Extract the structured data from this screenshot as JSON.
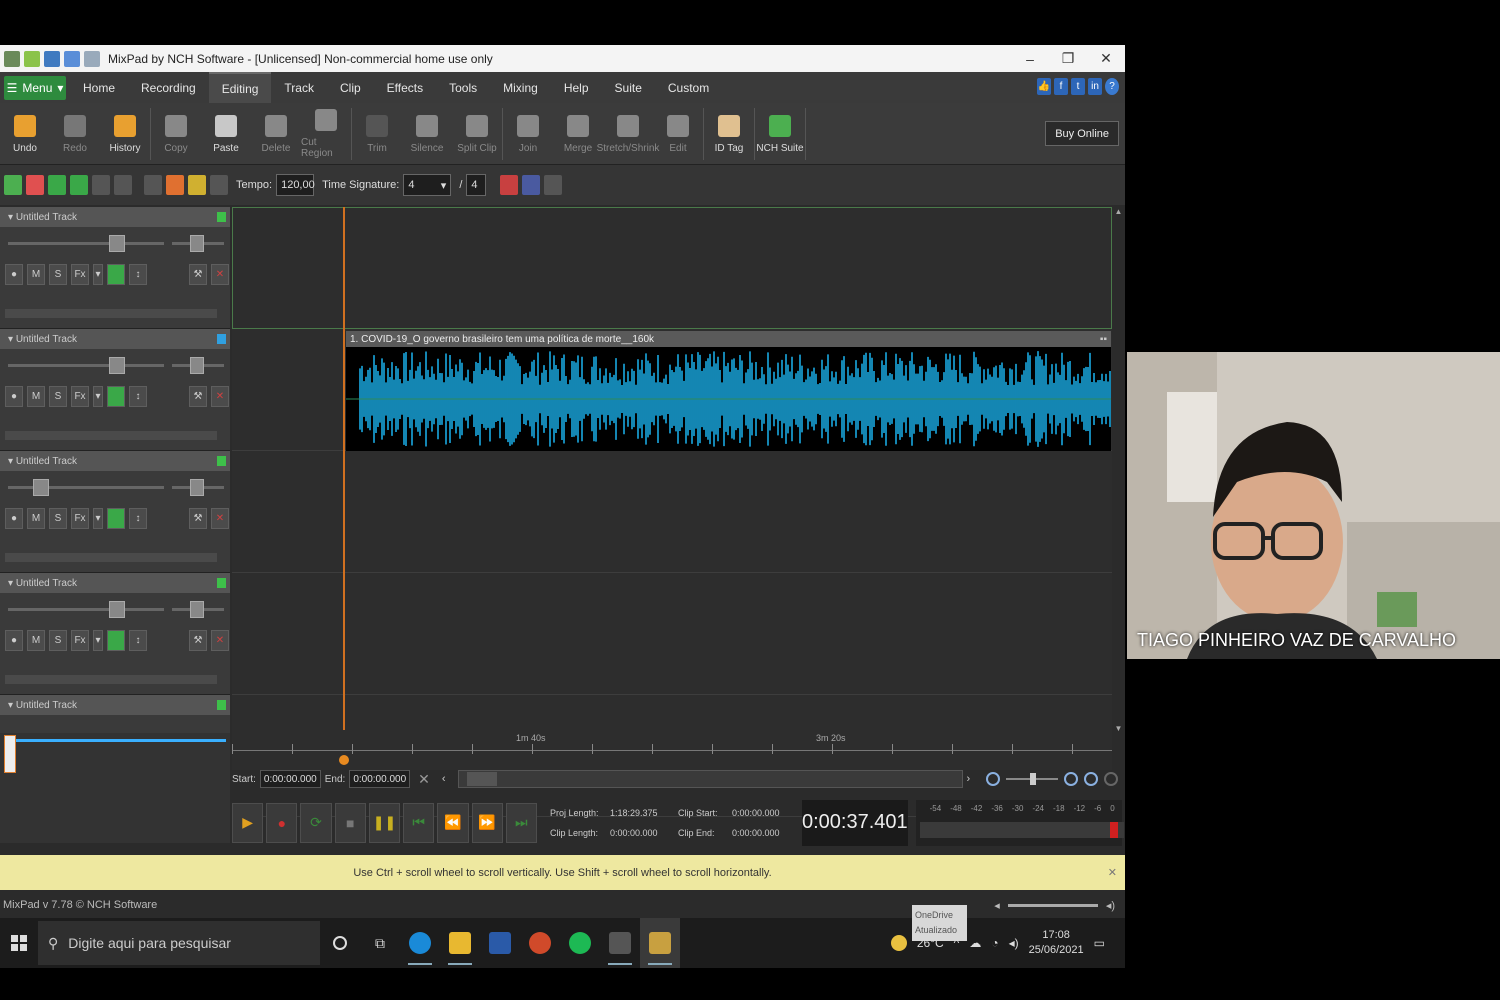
{
  "window": {
    "title": "MixPad by NCH Software - [Unlicensed] Non-commercial home use only",
    "controls": [
      "–",
      "❐",
      "✕"
    ]
  },
  "menu": {
    "menu_button": "Menu",
    "tabs": [
      "Home",
      "Recording",
      "Editing",
      "Track",
      "Clip",
      "Effects",
      "Tools",
      "Mixing",
      "Help",
      "Suite",
      "Custom"
    ],
    "active_tab": "Editing"
  },
  "toolbar": {
    "buttons": [
      {
        "label": "Undo",
        "enabled": true,
        "color": "#e8a030"
      },
      {
        "label": "Redo",
        "enabled": false,
        "color": "#777777"
      },
      {
        "label": "History",
        "enabled": true,
        "color": "#e8a030"
      },
      {
        "label": "Copy",
        "enabled": false,
        "color": "#888888"
      },
      {
        "label": "Paste",
        "enabled": true,
        "color": "#c8c8c8"
      },
      {
        "label": "Delete",
        "enabled": false,
        "color": "#888888"
      },
      {
        "label": "Cut Region",
        "enabled": false,
        "color": "#888888"
      },
      {
        "label": "Trim",
        "enabled": false,
        "color": "#555555"
      },
      {
        "label": "Silence",
        "enabled": false,
        "color": "#888888"
      },
      {
        "label": "Split Clip",
        "enabled": false,
        "color": "#888888"
      },
      {
        "label": "Join",
        "enabled": false,
        "color": "#888888"
      },
      {
        "label": "Merge",
        "enabled": false,
        "color": "#888888"
      },
      {
        "label": "Stretch/Shrink",
        "enabled": false,
        "color": "#888888"
      },
      {
        "label": "Edit",
        "enabled": false,
        "color": "#888888"
      },
      {
        "label": "ID Tag",
        "enabled": true,
        "color": "#e0c090"
      },
      {
        "label": "NCH Suite",
        "enabled": true,
        "color": "#4caf50"
      }
    ],
    "buy_online": "Buy Online"
  },
  "toolbar2": {
    "tempo_label": "Tempo:",
    "tempo_value": "120,00",
    "time_sig_label": "Time Signature:",
    "time_sig_num": "4",
    "time_sig_den": "4"
  },
  "tracks": [
    {
      "name": "Untitled Track",
      "color": "#3ec04a",
      "volume": 0.72
    },
    {
      "name": "Untitled Track",
      "color": "#30a0e0",
      "volume": 0.72
    },
    {
      "name": "Untitled Track",
      "color": "#3ec04a",
      "volume": 0.18
    },
    {
      "name": "Untitled Track",
      "color": "#3ec04a",
      "volume": 0.72
    },
    {
      "name": "Untitled Track",
      "color": "#3ec04a",
      "volume": 0.72
    }
  ],
  "track_buttons": [
    "●",
    "M",
    "S",
    "Fx",
    "▾",
    "",
    "↕"
  ],
  "clip": {
    "title": "1. COVID-19_O governo brasileiro tem uma política de morte__160k",
    "color": "#1aa8e0"
  },
  "ruler": {
    "labels": [
      "1m 40s",
      "3m 20s"
    ]
  },
  "selection": {
    "start_label": "Start:",
    "start_value": "0:00:00.000",
    "end_label": "End:",
    "end_value": "0:00:00.000"
  },
  "project": {
    "proj_length_label": "Proj Length:",
    "proj_length": "1:18:29.375",
    "clip_start_label": "Clip Start:",
    "clip_start": "0:00:00.000",
    "clip_length_label": "Clip Length:",
    "clip_length": "0:00:00.000",
    "clip_end_label": "Clip End:",
    "clip_end": "0:00:00.000"
  },
  "timecode": "0:00:37.401",
  "meter": {
    "labels": [
      "-54",
      "-48",
      "-42",
      "-36",
      "-30",
      "-24",
      "-18",
      "-12",
      "-6",
      "0"
    ]
  },
  "hint": "Use Ctrl + scroll wheel to scroll vertically. Use Shift + scroll wheel to scroll horizontally.",
  "status": "MixPad v 7.78 © NCH Software",
  "taskbar": {
    "search_placeholder": "Digite aqui para pesquisar",
    "weather": "26°C",
    "time": "17:08",
    "date": "25/06/2021",
    "tooltip": "OneDrive Atualizado"
  },
  "webcam": {
    "name": "TIAGO PINHEIRO VAZ DE CARVALHO"
  }
}
